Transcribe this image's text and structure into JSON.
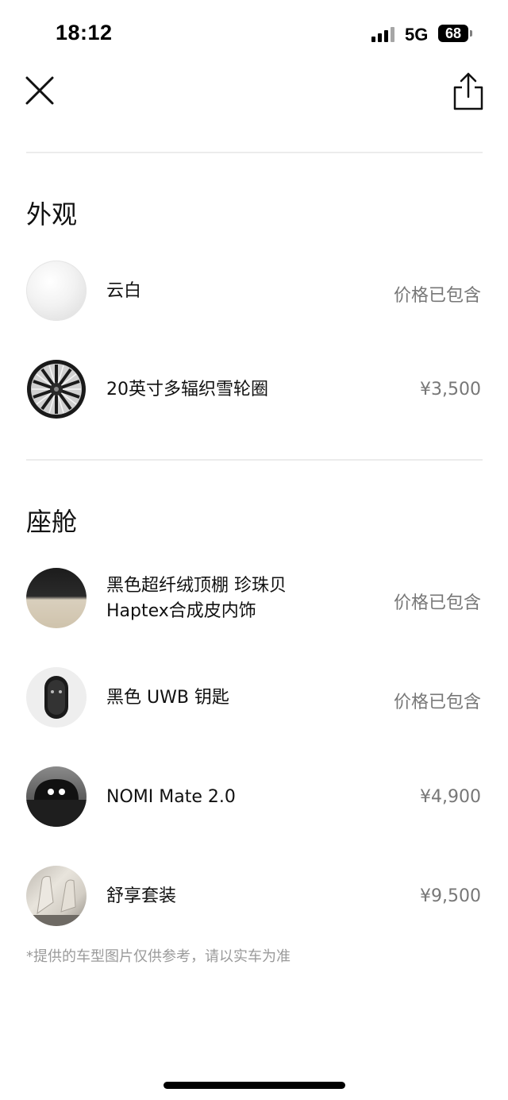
{
  "status_bar": {
    "time": "18:12",
    "network": "5G",
    "battery": "68"
  },
  "nav": {
    "close_icon": "close-icon",
    "share_icon": "share-icon"
  },
  "sections": [
    {
      "title": "外观",
      "items": [
        {
          "label": "云白",
          "price": "价格已包含",
          "thumb": "white-paint-swatch"
        },
        {
          "label": "20英寸多辐织雪轮圈",
          "price": "¥3,500",
          "thumb": "wheel-image"
        }
      ]
    },
    {
      "title": "座舱",
      "items": [
        {
          "label_line1": "黑色超纤绒顶棚 珍珠贝",
          "label_line2": "Haptex合成皮内饰",
          "price": "价格已包含",
          "thumb": "interior-swatch"
        },
        {
          "label": "黑色 UWB 钥匙",
          "price": "价格已包含",
          "thumb": "key-image"
        },
        {
          "label": "NOMI Mate 2.0",
          "price": "¥4,900",
          "thumb": "nomi-image"
        },
        {
          "label": "舒享套装",
          "price": "¥9,500",
          "thumb": "seat-image"
        }
      ]
    }
  ],
  "footnote": "*提供的车型图片仅供参考，请以实车为准"
}
